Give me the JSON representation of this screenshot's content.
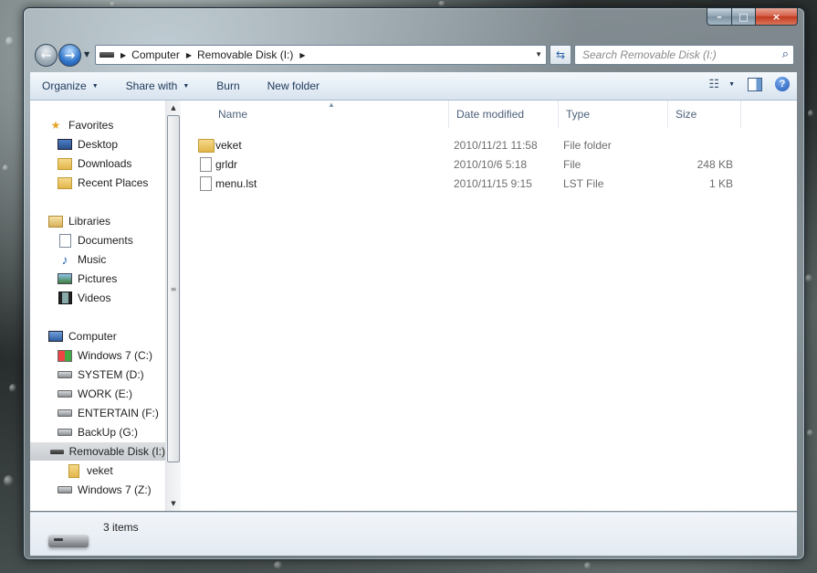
{
  "window": {
    "caption_buttons": [
      "–",
      "□",
      "×"
    ]
  },
  "address_bar": {
    "crumbs": [
      "Computer",
      "Removable Disk (I:)"
    ]
  },
  "search": {
    "placeholder": "Search Removable Disk (I:)"
  },
  "toolbar": {
    "organize": "Organize",
    "share_with": "Share with",
    "burn": "Burn",
    "new_folder": "New folder"
  },
  "nav_pane": {
    "favorites": {
      "label": "Favorites",
      "items": [
        "Desktop",
        "Downloads",
        "Recent Places"
      ]
    },
    "libraries": {
      "label": "Libraries",
      "items": [
        "Documents",
        "Music",
        "Pictures",
        "Videos"
      ]
    },
    "computer": {
      "label": "Computer",
      "items": [
        "Windows 7 (C:)",
        "SYSTEM (D:)",
        "WORK (E:)",
        "ENTERTAIN (F:)",
        "BackUp (G:)",
        "Removable Disk (I:)",
        "veket",
        "Windows 7 (Z:)"
      ]
    }
  },
  "columns": {
    "name": "Name",
    "date": "Date modified",
    "type": "Type",
    "size": "Size"
  },
  "files": [
    {
      "name": "veket",
      "date": "2010/11/21 11:58",
      "type": "File folder",
      "size": "",
      "icon": "folder-icon"
    },
    {
      "name": "grldr",
      "date": "2010/10/6 5:18",
      "type": "File",
      "size": "248 KB",
      "icon": "file-icon"
    },
    {
      "name": "menu.lst",
      "date": "2010/11/15 9:15",
      "type": "LST File",
      "size": "1 KB",
      "icon": "file-icon"
    }
  ],
  "status": {
    "item_count": "3 items"
  }
}
